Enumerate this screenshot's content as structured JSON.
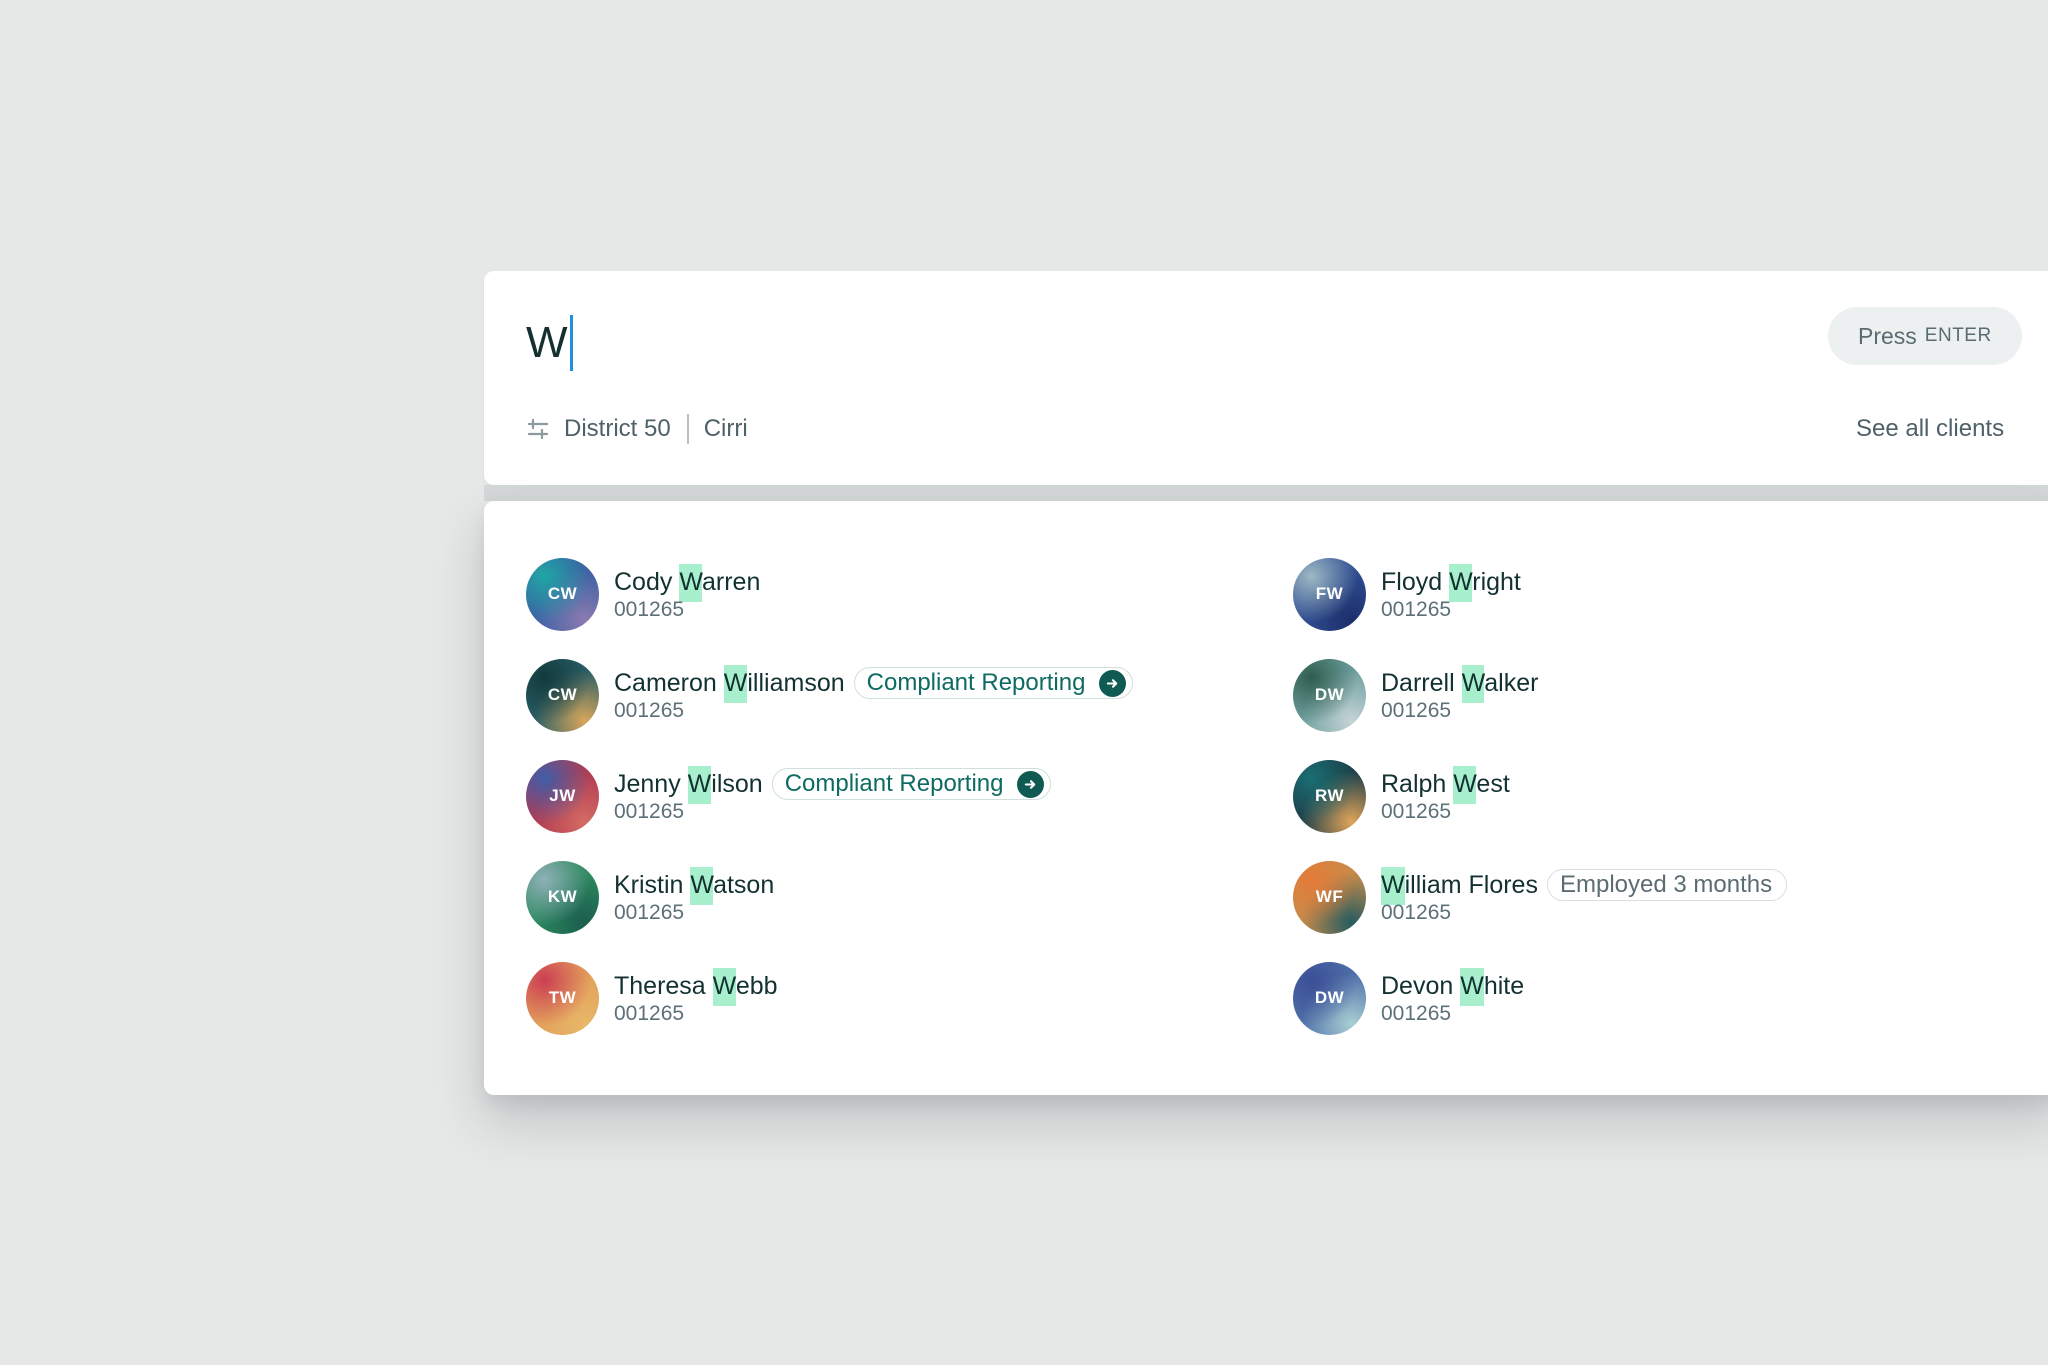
{
  "search": {
    "query": "W",
    "enter_hint_prefix": "Press",
    "enter_hint_key": "ENTER",
    "filters": {
      "district": "District 50",
      "org": "Cirri"
    },
    "see_all_label": "See all clients"
  },
  "results": [
    {
      "initials": "CW",
      "pre": "Cody ",
      "match": "W",
      "post": "arren",
      "id": "001265",
      "tag": null,
      "avatar_colors": [
        "#1fa6a5",
        "#3c5fa4",
        "#8a7bb0"
      ]
    },
    {
      "initials": "CW",
      "pre": "Cameron ",
      "match": "W",
      "post": "illiamson",
      "id": "001265",
      "tag": {
        "label": "Compliant Reporting",
        "style": "green"
      },
      "avatar_colors": [
        "#123a3d",
        "#2a5f66",
        "#d9a65a"
      ]
    },
    {
      "initials": "JW",
      "pre": "Jenny ",
      "match": "W",
      "post": "ilson",
      "id": "001265",
      "tag": {
        "label": "Compliant Reporting",
        "style": "green"
      },
      "avatar_colors": [
        "#3f5da8",
        "#b23b52",
        "#d46a63"
      ]
    },
    {
      "initials": "KW",
      "pre": "Kristin ",
      "match": "W",
      "post": "atson",
      "id": "001265",
      "tag": null,
      "avatar_colors": [
        "#8fb0b8",
        "#2c8a5e",
        "#1b5d4e"
      ]
    },
    {
      "initials": "TW",
      "pre": "Theresa ",
      "match": "W",
      "post": "ebb",
      "id": "001265",
      "tag": null,
      "avatar_colors": [
        "#cc3e54",
        "#e2a059",
        "#e8b768"
      ]
    },
    {
      "initials": "FW",
      "pre": "Floyd ",
      "match": "W",
      "post": "right",
      "id": "001265",
      "tag": null,
      "avatar_colors": [
        "#9db8c4",
        "#2f4e92",
        "#1c2f6b"
      ]
    },
    {
      "initials": "DW",
      "pre": "Darrell ",
      "match": "W",
      "post": "alker",
      "id": "001265",
      "tag": null,
      "avatar_colors": [
        "#2f5e4e",
        "#6fa0a0",
        "#c5d3d6"
      ]
    },
    {
      "initials": "RW",
      "pre": "Ralph ",
      "match": "W",
      "post": "est",
      "id": "001265",
      "tag": null,
      "avatar_colors": [
        "#1a6e73",
        "#1d3d47",
        "#e0a45a"
      ]
    },
    {
      "initials": "WF",
      "pre": "",
      "match": "W",
      "post": "illiam Flores",
      "id": "001265",
      "tag": {
        "label": "Employed 3 months",
        "style": "grey"
      },
      "avatar_colors": [
        "#e47b38",
        "#c78c4c",
        "#245b5f"
      ]
    },
    {
      "initials": "DW",
      "pre": "Devon ",
      "match": "W",
      "post": "hite",
      "id": "001265",
      "tag": null,
      "avatar_colors": [
        "#3b4f97",
        "#4f70a8",
        "#a8cfd4"
      ]
    }
  ],
  "colors": {
    "background": "#e6e7e7",
    "highlight": "#a8f0cd",
    "accent_teal": "#0f5a53",
    "caret": "#1f8fe0"
  },
  "icons": {
    "filter": "sliders-icon",
    "tag_arrow": "arrow-right-circle-icon"
  }
}
